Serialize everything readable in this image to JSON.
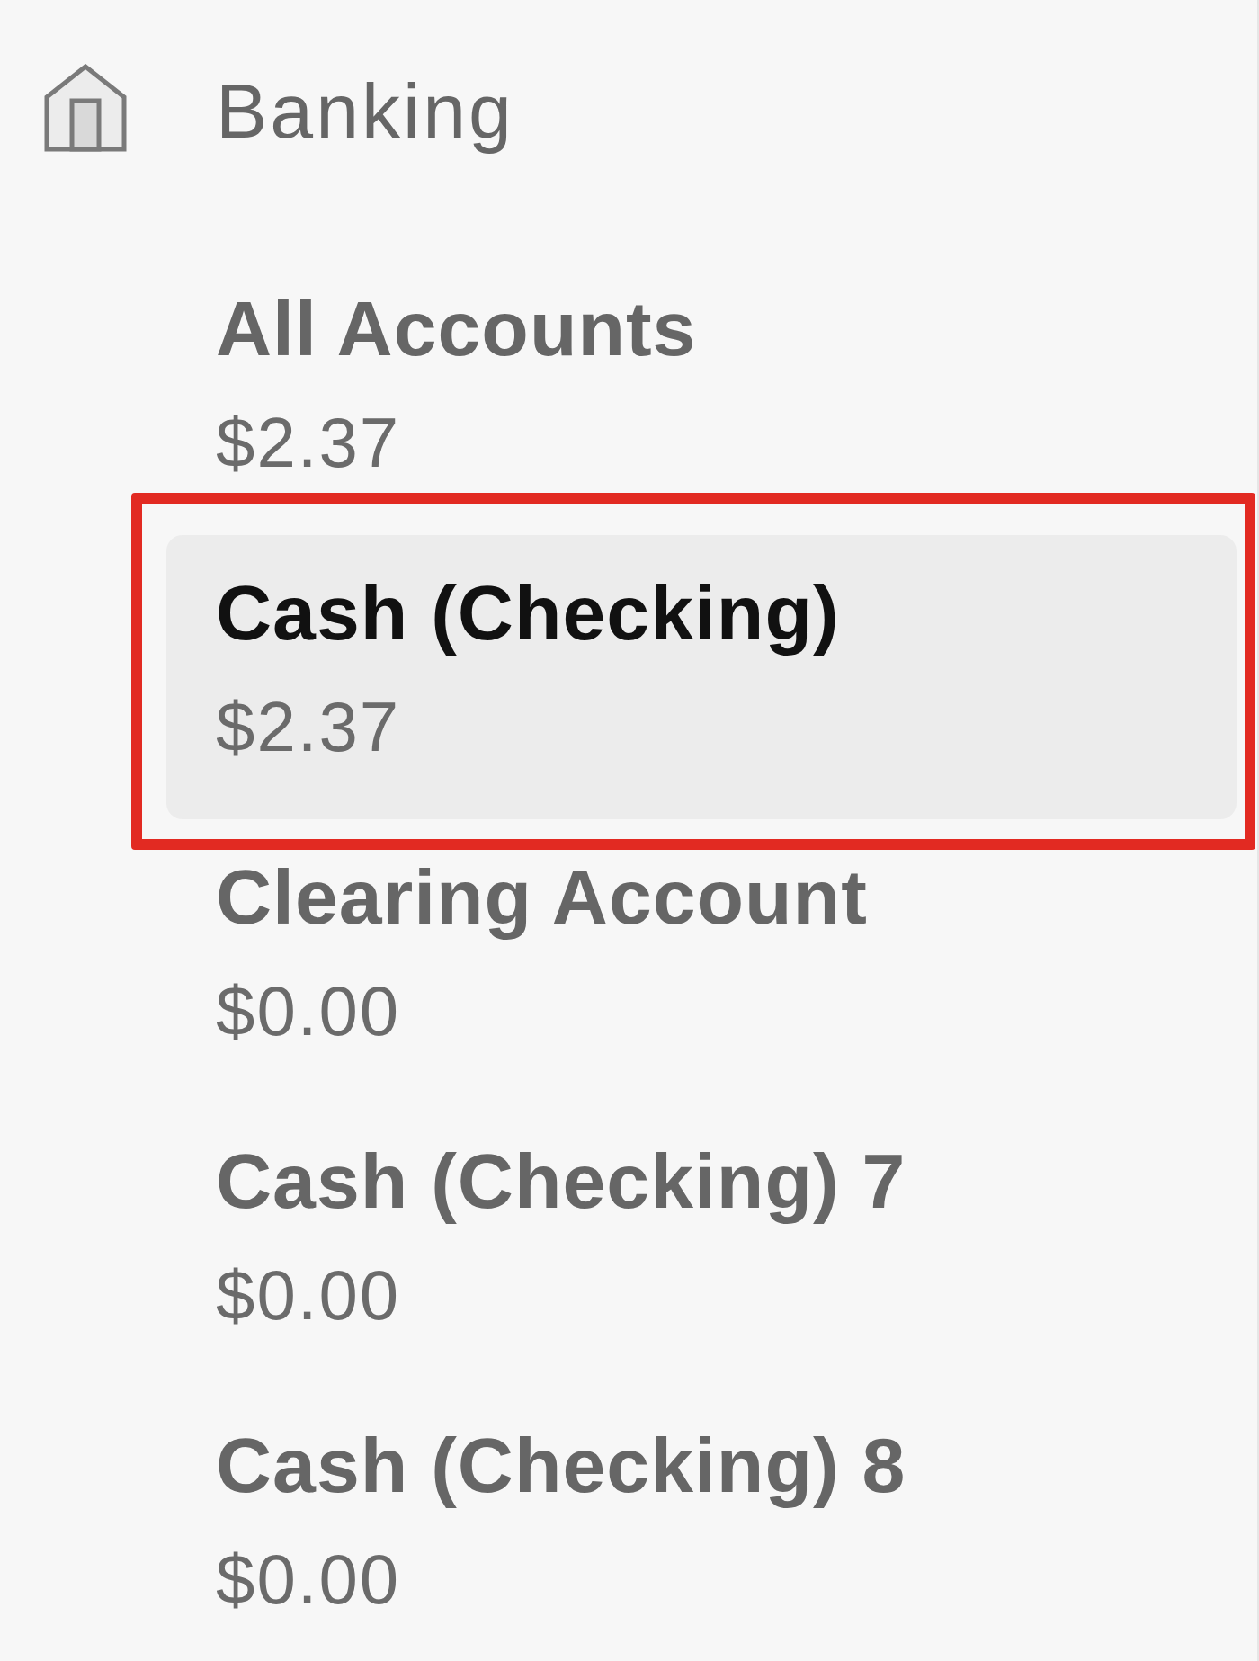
{
  "sidebar": {
    "section": {
      "title": "Banking"
    },
    "accounts": [
      {
        "name": "All Accounts",
        "balance": "$2.37",
        "selected": false,
        "highlighted": false
      },
      {
        "name": "Cash (Checking)",
        "balance": "$2.37",
        "selected": true,
        "highlighted": true
      },
      {
        "name": "Clearing Account",
        "balance": "$0.00",
        "selected": false,
        "highlighted": false
      },
      {
        "name": "Cash (Checking) 7",
        "balance": "$0.00",
        "selected": false,
        "highlighted": false
      },
      {
        "name": "Cash (Checking) 8",
        "balance": "$0.00",
        "selected": false,
        "highlighted": false
      }
    ]
  }
}
